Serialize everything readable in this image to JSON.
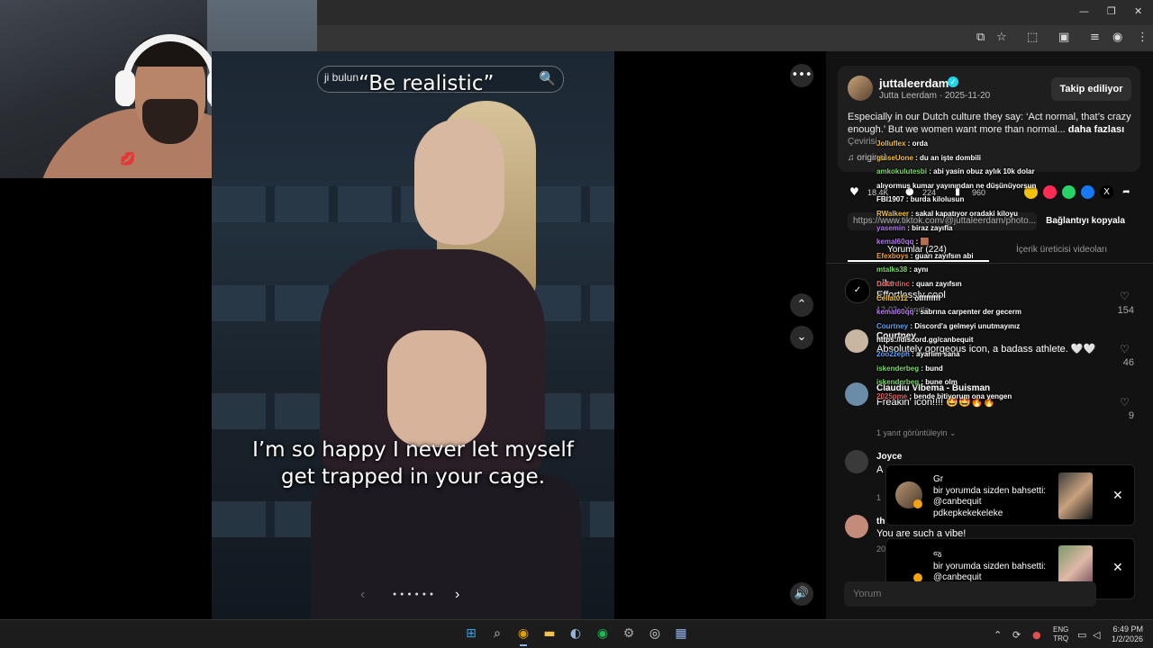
{
  "browser": {
    "window_controls": {
      "minimize": "—",
      "maximize": "❐",
      "close": "✕"
    },
    "toolbar_icons": [
      "screenshot-icon",
      "star-icon",
      "extensions-icon",
      "sidebar-icon",
      "tab-search-icon",
      "profile-icon",
      "menu-icon"
    ],
    "toolbar_glyphs": {
      "screenshot": "⧉",
      "star": "☆",
      "extensions": "⬚",
      "sidebar": "▣",
      "tab_search": "≡",
      "profile": "◉",
      "menu": "⋮"
    }
  },
  "video": {
    "search_partial": "ji bulun",
    "overlay_title": "“Be realistic”",
    "search_glyph": "🔍",
    "caption_line1": "I’m so happy I never let myself",
    "caption_line2": "get trapped in your cage.",
    "dots": "● ● ● ● ● ●",
    "prev": "‹",
    "next": "›",
    "more_glyph": "•••",
    "up_glyph": "⌃",
    "down_glyph": "⌄",
    "sound_glyph": "🔊"
  },
  "post": {
    "username": "juttaleerdam",
    "verified_glyph": "✓",
    "subline": "Jutta Leerdam · 2025-11-20",
    "follow_label": "Takip ediliyor",
    "description": "Especially in our Dutch culture they say: ‘Act normal, that’s crazy enough.’ But we women want more than normal...",
    "more_label": "daha fazlası",
    "translate_label": "Çevirisi",
    "music": "♫  original",
    "likes": "18.4K",
    "comments": "224",
    "saves": "960",
    "link": "https://www.tiktok.com/@juttaleerdam/photo...",
    "copy_link_label": "Bağlantıyı kopyala",
    "tab_comments": "Yorumlar (224)",
    "tab_creator": "İçerik üreticisi videoları",
    "share_colors": {
      "gold": "#f4c20d",
      "pink": "#fe2c55",
      "whatsapp": "#25d366",
      "facebook": "#1877f2",
      "x": "#000000"
    }
  },
  "comments": [
    {
      "name": "nike",
      "text": "Effortlessly cool",
      "sub": "12-02 · Yanıtla",
      "likes": "154",
      "avatar_color": "#000000"
    },
    {
      "name": "Courtney",
      "text": "Absolutely gorgeous icon, a badass athlete. 🤍🤍",
      "sub": "",
      "likes": "46",
      "avatar_color": "#c9b6a0"
    },
    {
      "name": "Claudiu Vlbema - Buisman",
      "text": "Freakin' icon!!!! 🤩🤩🔥🔥",
      "sub": "1 yanıt görüntüleyin ⌄",
      "likes": "9",
      "avatar_color": "#6a8ca8"
    },
    {
      "name": "Joyce",
      "text": "A",
      "sub": "1",
      "likes": "",
      "avatar_color": "#3a3a3a"
    },
    {
      "name": "th",
      "text": "You are such a vibe!",
      "sub": "20",
      "likes": "",
      "avatar_color": "#c48a7a"
    }
  ],
  "chat": [
    {
      "user": "Jolluflex",
      "msg": "orda",
      "color": "#f0c040"
    },
    {
      "user": "guiseUone",
      "msg": "du an işte dombili",
      "color": "#f0c040"
    },
    {
      "user": "amkokulutesbi",
      "msg": "abi yasin obuz aylık 10k dolar",
      "color": "#7bd86b"
    },
    {
      "user": "",
      "msg": "alıyormuş kumar yayınından ne düşünüyorsun",
      "color": "#ffffff"
    },
    {
      "user": "FBI1907",
      "msg": "burda kilolusun",
      "color": "#ffffff"
    },
    {
      "user": "RWalkeer",
      "msg": "sakal kapatıyor oradaki kiloyu",
      "color": "#f0c040"
    },
    {
      "user": "yasemin",
      "msg": "biraz zayıfla",
      "color": "#b07ae8"
    },
    {
      "user": "kemal60qq",
      "msg": "🟫",
      "color": "#b07ae8"
    },
    {
      "user": "Efexboys",
      "msg": "guarı zayıfsın abi",
      "color": "#f0a030"
    },
    {
      "user": "mtalks38",
      "msg": "aynı",
      "color": "#7bd86b"
    },
    {
      "user": "Dolardinc",
      "msg": "quan zayıfsın",
      "color": "#e06060"
    },
    {
      "user": "Cellat012",
      "msg": "offfffffff",
      "color": "#f0c040"
    },
    {
      "user": "kemal60qq",
      "msg": "sabrına carpenter der gecerm",
      "color": "#b07ae8"
    },
    {
      "user": "Courtney",
      "msg": "Discord'a gelmeyi unutmayınız",
      "color": "#60a0f0"
    },
    {
      "user": "",
      "msg": "https://discord.gg/canbequit",
      "color": "#ffffff"
    },
    {
      "user": "2oo2zeph",
      "msg": "ayarlim sana",
      "color": "#60a0f0"
    },
    {
      "user": "iskenderbeg",
      "msg": "bund",
      "color": "#7bd86b"
    },
    {
      "user": "",
      "msg": "",
      "color": "#ffffff"
    },
    {
      "user": "iskenderbeg",
      "msg": "bune olm",
      "color": "#7bd86b"
    },
    {
      "user": "2025pme",
      "msg": "bende bitiyorum ona yengen",
      "color": "#e06060"
    }
  ],
  "notifications": [
    {
      "name": "Gr",
      "line1": "bir yorumda sizden bahsetti:",
      "line2": "@canbequit",
      "line3": "pdkepkekekeleke",
      "close": "✕"
    },
    {
      "name": "જ",
      "line1": "bir yorumda sizden bahsetti:",
      "line2": "@canbequit",
      "line3": "",
      "close": "✕"
    }
  ],
  "comment_input": {
    "placeholder": "Yorum"
  },
  "taskbar": {
    "apps": [
      "windows-icon",
      "search-icon",
      "chrome-icon",
      "explorer-icon",
      "steam-icon",
      "spotify-icon",
      "settings-icon",
      "obs-icon",
      "app-icon"
    ],
    "glyphs": {
      "windows": "⊞",
      "search": "⌕",
      "chrome": "◉",
      "explorer": "▬",
      "steam": "◐",
      "spotify": "◉",
      "settings": "⚙",
      "obs": "◎",
      "app": "▦"
    },
    "colors": {
      "windows": "#2ea3f2",
      "chrome": "#e0a000",
      "explorer": "#f2c14e",
      "steam": "#9ab6d6",
      "spotify": "#1db954",
      "settings": "#aaaaaa",
      "obs": "#dddddd",
      "app": "#8fb0e8"
    },
    "tray_chevron": "⌃",
    "lang_top": "ENG",
    "lang_bottom": "TRQ",
    "time": "6:49 PM",
    "date": "1/2/2026"
  }
}
